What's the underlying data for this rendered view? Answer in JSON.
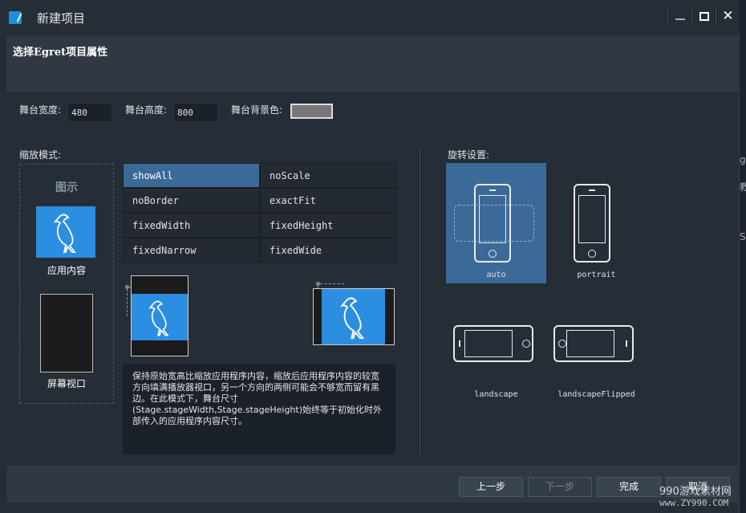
{
  "window": {
    "title": "新建项目"
  },
  "header": {
    "title": "选择Egret项目属性"
  },
  "stage": {
    "width_label": "舞台宽度:",
    "width_value": "480",
    "height_label": "舞台高度:",
    "height_value": "800",
    "bg_label": "舞台背景色:",
    "bg_color": "#777777"
  },
  "scale": {
    "label": "缩放模式:",
    "preview_heading": "图示",
    "content_label": "应用内容",
    "screen_label": "屏幕视口",
    "modes": [
      "showAll",
      "noScale",
      "noBorder",
      "exactFit",
      "fixedWidth",
      "fixedHeight",
      "fixedNarrow",
      "fixedWide"
    ],
    "selected": "showAll",
    "description": "保持原始宽高比缩放应用程序内容，缩放后应用程序内容的较宽方向填满播放器视口，另一个方向的两侧可能会不够宽而留有黑边。在此模式下，舞台尺寸(Stage.stageWidth,Stage.stageHeight)始终等于初始化时外部传入的应用程序内容尺寸。"
  },
  "rotation": {
    "label": "旋转设置:",
    "options": [
      "auto",
      "portrait",
      "landscape",
      "landscapeFlipped"
    ],
    "selected": "auto"
  },
  "footer": {
    "prev": "上一步",
    "next": "下一步",
    "finish": "完成",
    "cancel": "取消"
  },
  "watermark": {
    "line1": "990游戏素材网",
    "line2": "www.ZY990.COM"
  },
  "edge_glyphs": [
    "g",
    "教",
    "S"
  ]
}
